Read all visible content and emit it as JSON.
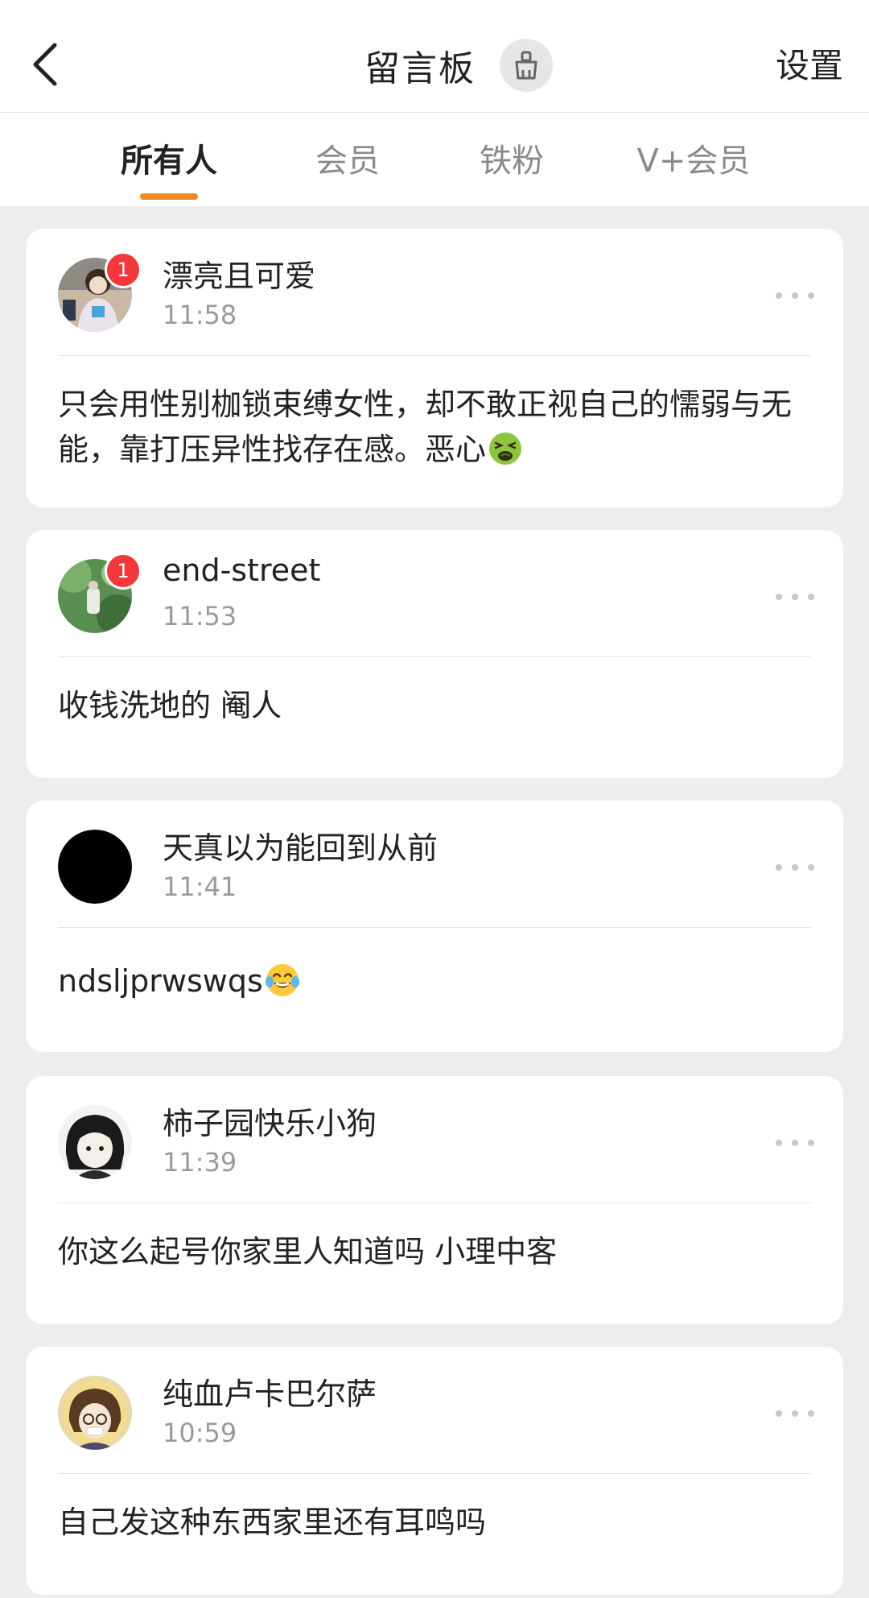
{
  "header": {
    "title": "留言板",
    "settings_label": "设置"
  },
  "tabs": [
    {
      "label": "所有人",
      "active": true
    },
    {
      "label": "会员",
      "active": false
    },
    {
      "label": "铁粉",
      "active": false
    },
    {
      "label": "V+会员",
      "active": false
    }
  ],
  "colors": {
    "accent": "#f08a24",
    "badge": "#f2383a",
    "background": "#ededed"
  },
  "messages": [
    {
      "username": "漂亮且可爱",
      "time": "11:58",
      "badge": "1",
      "text": "只会用性别枷锁束缚女性，却不敢正视自己的懦弱与无能，靠打压异性找存在感。恶心",
      "emoji": "nauseated-face-emoji"
    },
    {
      "username": "end-street",
      "time": "11:53",
      "badge": "1",
      "text": "收钱洗地的 阉人"
    },
    {
      "username": "天真以为能回到从前",
      "time": "11:41",
      "text": "ndsljprwswqs",
      "emoji": "tears-of-joy-emoji"
    },
    {
      "username": "柿子园快乐小狗",
      "time": "11:39",
      "text": "你这么起号你家里人知道吗 小理中客"
    },
    {
      "username": "纯血卢卡巴尔萨",
      "time": "10:59",
      "text": "自己发这种东西家里还有耳鸣吗"
    }
  ]
}
